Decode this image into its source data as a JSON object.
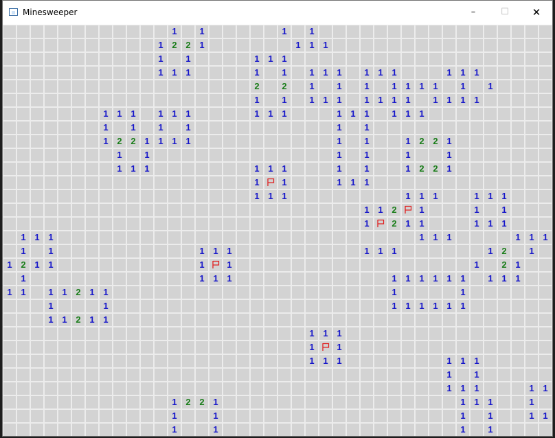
{
  "window": {
    "title": "Minesweeper",
    "minimize_glyph": "–",
    "maximize_glyph": "☐",
    "close_glyph": "✕",
    "icon": "app-window-icon"
  },
  "board": {
    "columns": 40,
    "rows": 30,
    "colors": {
      "hidden": "#d3d3d3",
      "revealed_empty": "#ffffff",
      "grid": "#ececec",
      "one": "#1515c9",
      "two": "#1a7d1a",
      "flag": "#e02020"
    },
    "revealed": [
      "............1.1.....1.1.................",
      "...........1221......111................",
      "...........1.1....111...................",
      "...........111....1.1.111.111...111.....",
      "..................2.2.1.1.1.1111.1.1....",
      "..................1.1.111.1111.1111.....",
      ".......111.111....111...111.111.........",
      ".......1.1.1.1..........1.1.............",
      ".......1221111..........1.1..1221.......",
      "........1.1.............1.1..1..1.......",
      "........111.......111...1.1..1221.......",
      "..................1F1...111.............",
      "..................111........111..111...",
      "..........................112F1...1.1...",
      "..........................1F211...111...",
      ".111..........................111....111.",
      ".1.1..........111.........111......12.1.",
      "1211..........1F1.................1.21..",
      ".1............111...........111111.111..",
      "11.11211....................1....1......",
      "...1...1....................111111......",
      "...11211................................",
      "......................111...............",
      "......................1F1...............",
      "......................111.......111.....",
      "................................1.1.....",
      "................................111...11",
      "............1221.................111..1.",
      "............1..1.................1.1..11",
      "............1..1.................1.1...."
    ],
    "note": "not used"
  }
}
